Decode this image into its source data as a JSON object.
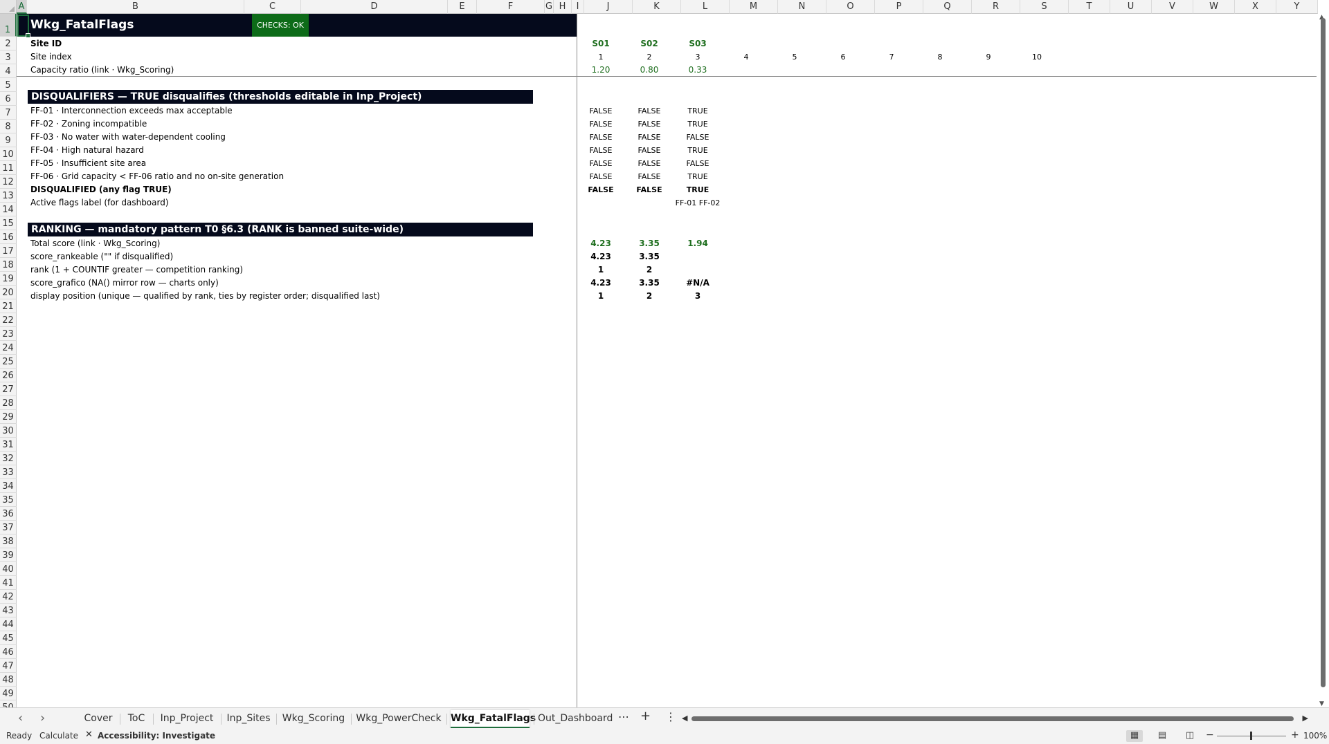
{
  "columns": [
    "A",
    "B",
    "C",
    "D",
    "E",
    "F",
    "G",
    "H",
    "I",
    "J",
    "K",
    "L",
    "M",
    "N",
    "O",
    "P",
    "Q",
    "R",
    "S",
    "T",
    "U",
    "V",
    "W",
    "X",
    "Y"
  ],
  "rows": [
    "1",
    "2",
    "3",
    "4",
    "5",
    "6",
    "7",
    "8",
    "9",
    "10",
    "11",
    "12",
    "13",
    "14",
    "15",
    "16",
    "17",
    "18",
    "19",
    "20",
    "21",
    "22",
    "23",
    "24",
    "25",
    "26",
    "27",
    "28",
    "29",
    "30",
    "31",
    "32",
    "33",
    "34",
    "35",
    "36",
    "37",
    "38",
    "39",
    "40",
    "41",
    "42",
    "43",
    "44",
    "45",
    "46",
    "47",
    "48",
    "49",
    "50"
  ],
  "active_cell": {
    "column": "A",
    "row": "1"
  },
  "sheet_title": "Wkg_FatalFlags",
  "checks_badge": "CHECKS: OK",
  "header_rows": {
    "site_id_label": "Site ID",
    "site_index_label": "Site index",
    "capacity_label": "Capacity ratio (link · Wkg_Scoring)"
  },
  "site_ids": [
    "S01",
    "S02",
    "S03"
  ],
  "site_indices": [
    "1",
    "2",
    "3",
    "4",
    "5",
    "6",
    "7",
    "8",
    "9",
    "10"
  ],
  "capacity_ratios": [
    "1.20",
    "0.80",
    "0.33"
  ],
  "disqualifiers": {
    "header": "DISQUALIFIERS — TRUE disqualifies (thresholds editable in Inp_Project)",
    "rows": [
      {
        "label": "FF-01 · Interconnection exceeds max acceptable",
        "values": [
          "FALSE",
          "FALSE",
          "TRUE"
        ]
      },
      {
        "label": "FF-02 · Zoning incompatible",
        "values": [
          "FALSE",
          "FALSE",
          "TRUE"
        ]
      },
      {
        "label": "FF-03 · No water with water-dependent cooling",
        "values": [
          "FALSE",
          "FALSE",
          "FALSE"
        ]
      },
      {
        "label": "FF-04 · High natural hazard",
        "values": [
          "FALSE",
          "FALSE",
          "TRUE"
        ]
      },
      {
        "label": "FF-05 · Insufficient site area",
        "values": [
          "FALSE",
          "FALSE",
          "FALSE"
        ]
      },
      {
        "label": "FF-06 · Grid capacity < FF-06 ratio and no on-site generation",
        "values": [
          "FALSE",
          "FALSE",
          "TRUE"
        ]
      }
    ],
    "disqualified_label": "DISQUALIFIED (any flag TRUE)",
    "disqualified_values": [
      "FALSE",
      "FALSE",
      "TRUE"
    ],
    "active_flags_label": "Active flags label (for dashboard)",
    "active_flags_values": [
      "",
      "",
      "FF-01 FF-02"
    ]
  },
  "ranking": {
    "header": "RANKING — mandatory pattern T0 §6.3 (RANK is banned suite-wide)",
    "total_score_label": "Total score (link · Wkg_Scoring)",
    "total_score_values": [
      "4.23",
      "3.35",
      "1.94"
    ],
    "rankeable_label": "score_rankeable (\"\" if disqualified)",
    "rankeable_values": [
      "4.23",
      "3.35",
      ""
    ],
    "rank_label": "rank (1 + COUNTIF greater — competition ranking)",
    "rank_values": [
      "1",
      "2",
      ""
    ],
    "grafico_label": "score_grafico (NA() mirror row — charts only)",
    "grafico_values": [
      "4.23",
      "3.35",
      "#N/A"
    ],
    "display_label": "display position (unique — qualified by rank, ties by register order; disqualified last)",
    "display_values": [
      "1",
      "2",
      "3"
    ]
  },
  "tabs": [
    "Cover",
    "ToC",
    "Inp_Project",
    "Inp_Sites",
    "Wkg_Scoring",
    "Wkg_PowerCheck",
    "Wkg_FatalFlags",
    "Out_Dashboard"
  ],
  "active_tab": "Wkg_FatalFlags",
  "tab_controls": {
    "more": "⋯",
    "add": "+",
    "menu": "⋮",
    "prev": "‹",
    "next": "›"
  },
  "status": {
    "ready": "Ready",
    "calculate": "Calculate",
    "accessibility": "Accessibility: Investigate",
    "zoom": "100%",
    "zoom_minus": "−",
    "zoom_plus": "+"
  },
  "colors": {
    "accent": "#1e6e3c",
    "banner_bg": "#050a1c",
    "badge_bg": "#0d6b18",
    "green_text": "#1e6e1e"
  }
}
